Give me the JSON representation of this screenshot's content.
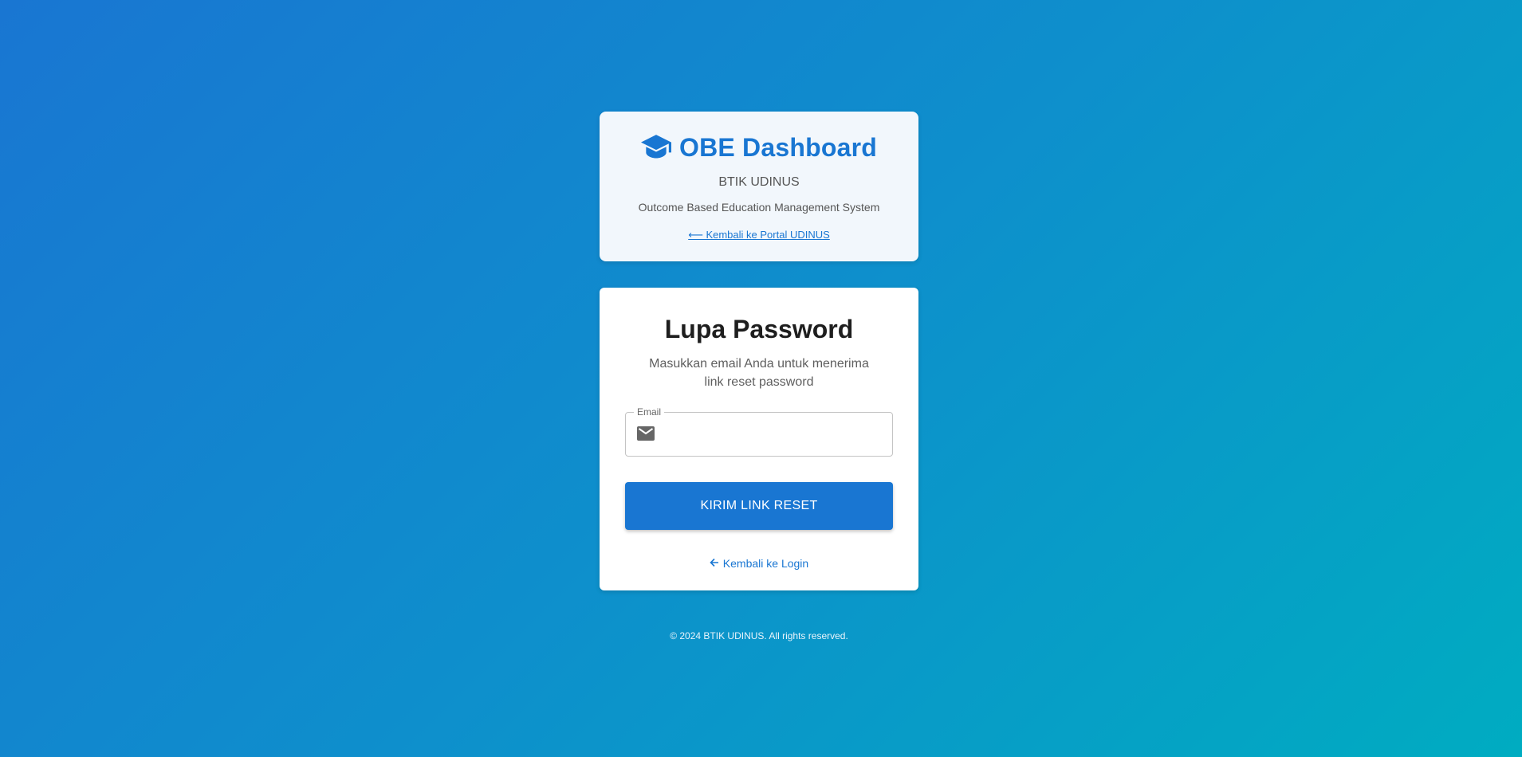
{
  "header": {
    "title": "OBE Dashboard",
    "icon": "graduation-cap-icon",
    "organization": "BTIK UDINUS",
    "tagline": "Outcome Based Education Management System",
    "back_portal_link": "⟵ Kembali ke Portal UDINUS"
  },
  "form": {
    "title": "Lupa Password",
    "description": "Masukkan email Anda untuk menerima link reset password",
    "email": {
      "label": "Email",
      "value": "",
      "icon": "email-icon"
    },
    "submit_label": "KIRIM LINK RESET",
    "back_login_label": "Kembali ke Login",
    "back_login_icon": "arrow-left-icon"
  },
  "footer": {
    "copyright": "© 2024 BTIK UDINUS. All rights reserved."
  },
  "colors": {
    "primary": "#1976d2",
    "gradient_start": "#1976d2",
    "gradient_end": "#00acc1"
  }
}
